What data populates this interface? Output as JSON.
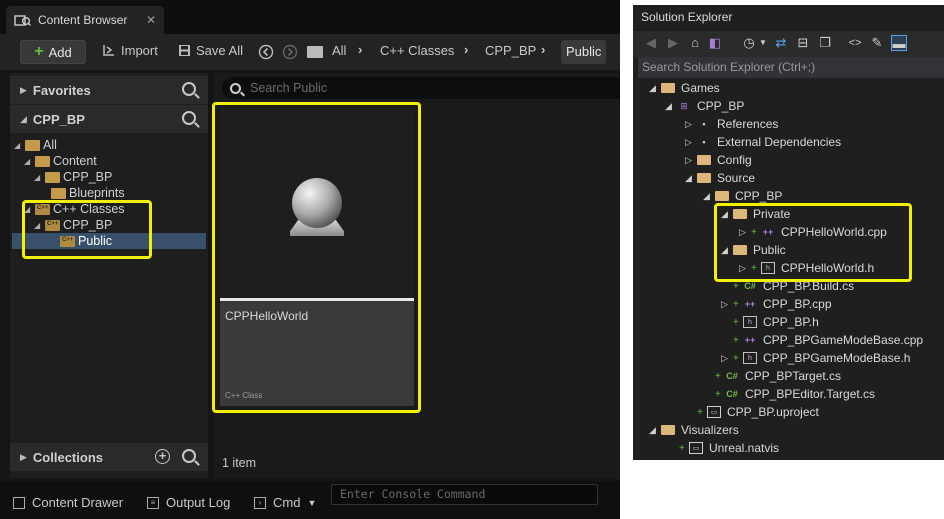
{
  "ue": {
    "tab_title": "Content Browser",
    "tab_close": "✕",
    "toolbar": {
      "add_label": "Add",
      "import_label": "Import",
      "save_all_label": "Save All"
    },
    "breadcrumb": [
      "All",
      "C++ Classes",
      "CPP_BP",
      "Public"
    ],
    "favorites_label": "Favorites",
    "project_label": "CPP_BP",
    "collections_label": "Collections",
    "tree": {
      "all": "All",
      "content": "Content",
      "cpp_bp_content": "CPP_BP",
      "blueprints": "Blueprints",
      "cpp_classes": "C++ Classes",
      "cpp_bp_classes": "CPP_BP",
      "public": "Public"
    },
    "search_placeholder": "Search Public",
    "asset": {
      "name": "CPPHelloWorld",
      "type": "C++ Class"
    },
    "item_count": "1 item",
    "bottom": {
      "content_drawer": "Content Drawer",
      "output_log": "Output Log",
      "cmd": "Cmd",
      "console_placeholder": "Enter Console Command"
    },
    "highlight_color": "#f2f200"
  },
  "se": {
    "title": "Solution Explorer",
    "search_placeholder": "Search Solution Explorer (Ctrl+;)",
    "rows": [
      {
        "label": "Games",
        "kind": "folder",
        "expand": "◢"
      },
      {
        "label": "CPP_BP",
        "kind": "project",
        "expand": "◢"
      },
      {
        "label": "References",
        "kind": "ref",
        "expand": "▷"
      },
      {
        "label": "External Dependencies",
        "kind": "ref",
        "expand": "▷"
      },
      {
        "label": "Config",
        "kind": "folder",
        "expand": "▷"
      },
      {
        "label": "Source",
        "kind": "folder",
        "expand": "◢"
      },
      {
        "label": "CPP_BP",
        "kind": "folder",
        "expand": "◢"
      },
      {
        "label": "Private",
        "kind": "folder",
        "expand": "◢"
      },
      {
        "label": "CPPHelloWorld.cpp",
        "kind": "cpp",
        "expand": "▷"
      },
      {
        "label": "Public",
        "kind": "folder",
        "expand": "◢"
      },
      {
        "label": "CPPHelloWorld.h",
        "kind": "h",
        "expand": "▷"
      },
      {
        "label": "CPP_BP.Build.cs",
        "kind": "cs",
        "expand": ""
      },
      {
        "label": "CPP_BP.cpp",
        "kind": "cpp",
        "expand": "▷"
      },
      {
        "label": "CPP_BP.h",
        "kind": "h",
        "expand": ""
      },
      {
        "label": "CPP_BPGameModeBase.cpp",
        "kind": "cpp",
        "expand": ""
      },
      {
        "label": "CPP_BPGameModeBase.h",
        "kind": "h",
        "expand": "▷"
      },
      {
        "label": "CPP_BPTarget.cs",
        "kind": "cs",
        "expand": ""
      },
      {
        "label": "CPP_BPEditor.Target.cs",
        "kind": "cs",
        "expand": ""
      },
      {
        "label": "CPP_BP.uproject",
        "kind": "file",
        "expand": ""
      },
      {
        "label": "Visualizers",
        "kind": "folder",
        "expand": "◢"
      },
      {
        "label": "Unreal.natvis",
        "kind": "file",
        "expand": ""
      }
    ]
  }
}
